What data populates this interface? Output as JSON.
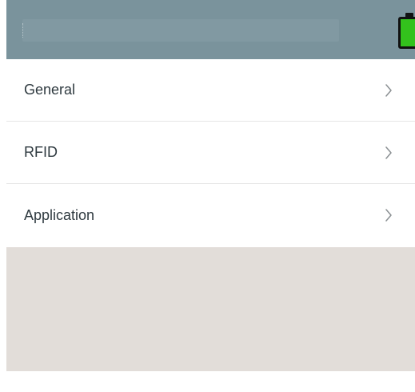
{
  "menu": {
    "items": [
      {
        "label": "General",
        "icon": "chevron-right-icon"
      },
      {
        "label": "RFID",
        "icon": "chevron-right-icon"
      },
      {
        "label": "Application",
        "icon": "chevron-right-icon"
      }
    ]
  },
  "status": {
    "battery_icon": "battery-icon",
    "battery_color": "#33c21c"
  },
  "colors": {
    "header": "#7a939c",
    "background_empty": "#e2ddd9",
    "text": "#2f3a40",
    "chevron": "#8a8f92"
  }
}
